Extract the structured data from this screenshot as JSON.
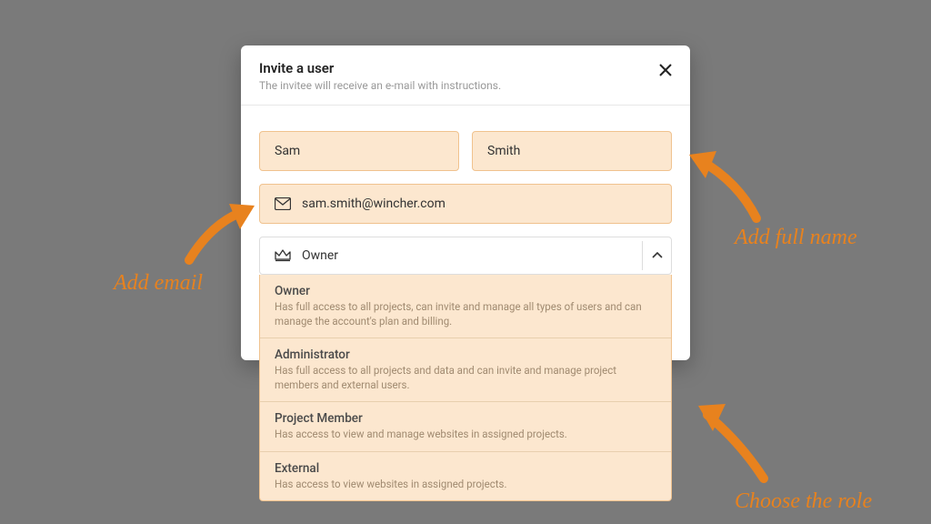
{
  "modal": {
    "title": "Invite a user",
    "subtitle": "The invitee will receive an e-mail with instructions."
  },
  "form": {
    "first_name": "Sam",
    "last_name": "Smith",
    "email": "sam.smith@wincher.com",
    "role_selected": "Owner"
  },
  "roles": [
    {
      "name": "Owner",
      "desc": "Has full access to all projects, can invite and manage all types of users and can manage the account's plan and billing."
    },
    {
      "name": "Administrator",
      "desc": "Has full access to all projects and data and can invite and manage project members and external users."
    },
    {
      "name": "Project Member",
      "desc": "Has access to view and manage websites in assigned projects."
    },
    {
      "name": "External",
      "desc": "Has access to view websites in assigned projects."
    }
  ],
  "annotations": {
    "name": "Add full name",
    "email": "Add email",
    "role": "Choose the role"
  }
}
